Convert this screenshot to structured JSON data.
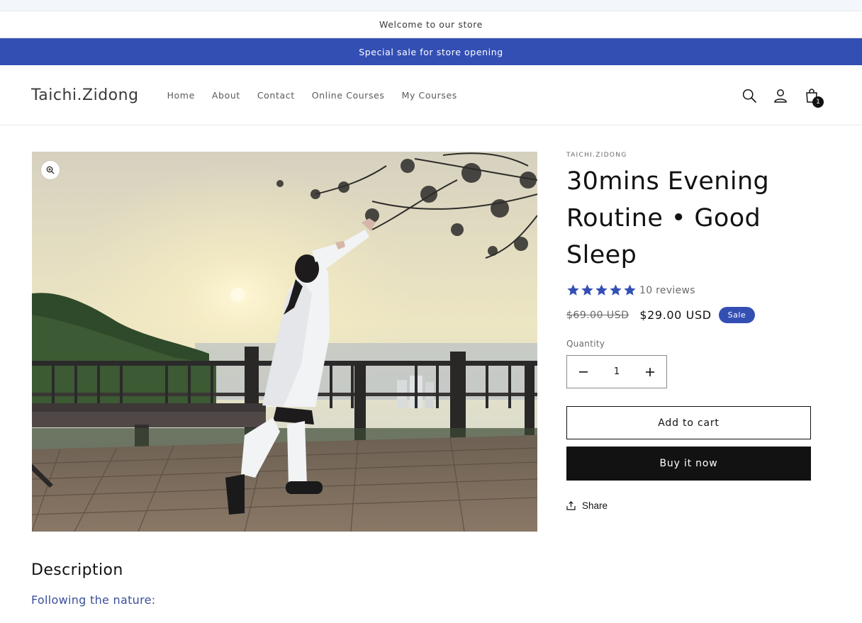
{
  "announcement": {
    "welcome": "Welcome to our store",
    "sale": "Special sale for store opening"
  },
  "header": {
    "logo": "Taichi.Zidong",
    "nav": [
      "Home",
      "About",
      "Contact",
      "Online Courses",
      "My Courses"
    ],
    "cart_count": "1",
    "icons": [
      "search-icon",
      "account-icon",
      "cart-icon"
    ]
  },
  "product": {
    "vendor": "TAICHI.ZIDONG",
    "title": "30mins Evening Routine • Good Sleep",
    "rating": 5,
    "reviews": "10 reviews",
    "price_old": "$69.00 USD",
    "price_new": "$29.00 USD",
    "sale_label": "Sale",
    "quantity_label": "Quantity",
    "quantity": "1",
    "add_to_cart": "Add to cart",
    "buy_now": "Buy it now",
    "share": "Share"
  },
  "description": {
    "title": "Description",
    "text": "Following the nature:"
  },
  "colors": {
    "accent": "#334fb4",
    "text": "#121212",
    "link": "#3a4f9a"
  }
}
